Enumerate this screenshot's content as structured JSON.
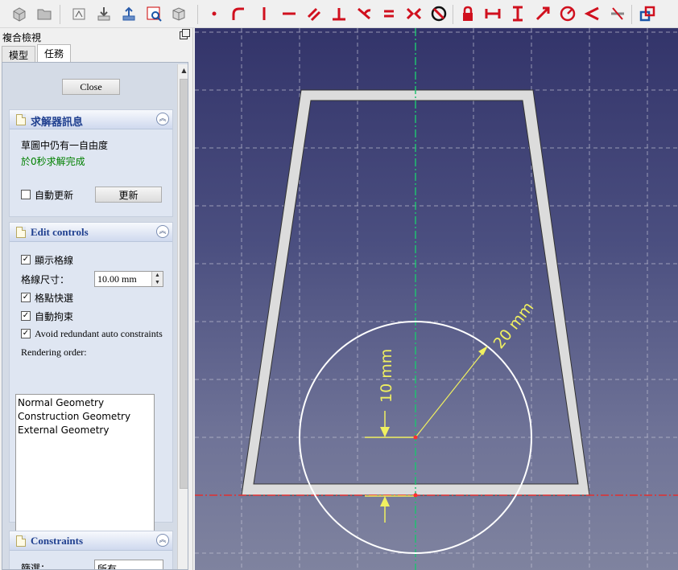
{
  "toolbar": {
    "buttons": [
      {
        "name": "part-icon"
      },
      {
        "name": "folder-icon"
      },
      {
        "name": "new-sketch-icon"
      },
      {
        "name": "attach-sketch-icon"
      },
      {
        "name": "leave-sketch-icon"
      },
      {
        "name": "view-section-icon"
      },
      {
        "name": "validate-sketch-icon"
      },
      {
        "name": "point-icon"
      },
      {
        "name": "arc-icon"
      },
      {
        "name": "vertical-constraint-icon"
      },
      {
        "name": "horizontal-constraint-icon"
      },
      {
        "name": "parallel-constraint-icon"
      },
      {
        "name": "perpendicular-constraint-icon"
      },
      {
        "name": "tangent-constraint-icon"
      },
      {
        "name": "equal-constraint-icon"
      },
      {
        "name": "symmetric-constraint-icon"
      },
      {
        "name": "block-constraint-icon"
      },
      {
        "name": "lock-constraint-icon"
      },
      {
        "name": "horizontal-distance-icon"
      },
      {
        "name": "vertical-distance-icon"
      },
      {
        "name": "distance-icon"
      },
      {
        "name": "radius-constraint-icon"
      },
      {
        "name": "angle-constraint-icon"
      },
      {
        "name": "snell-law-icon"
      },
      {
        "name": "toggle-driving-icon"
      }
    ]
  },
  "panel": {
    "title": "複合檢視",
    "tabs": [
      "模型",
      "任務"
    ],
    "close_label": "Close",
    "solver": {
      "title": "求解器訊息",
      "dof_text": "草圖中仍有一自由度",
      "solved_text": "於0秒求解完成",
      "auto_update_label": "自動更新",
      "update_button": "更新"
    },
    "edit_controls": {
      "title": "Edit controls",
      "show_grid_label": "顯示格線",
      "grid_size_label": "格線尺寸：",
      "grid_size_value": "10.00 mm",
      "grid_snap_label": "格點快選",
      "auto_constraints_label": "自動拘束",
      "avoid_redundant_label": "Avoid redundant auto constraints",
      "rendering_order_label": "Rendering order:",
      "rendering_order": [
        "Normal Geometry",
        "Construction Geometry",
        "External Geometry"
      ]
    },
    "constraints": {
      "title": "Constraints",
      "filter_label": "篩選：",
      "filter_value": "所有"
    }
  },
  "viewport": {
    "dim_radius": "20 mm",
    "dim_vertical": "10 mm"
  },
  "colors": {
    "accent_title": "#1f3f8f",
    "solved_text": "#008000",
    "dimension": "#f0f060",
    "axis_vertical": "#20c070",
    "axis_horizontal": "#e03030"
  }
}
